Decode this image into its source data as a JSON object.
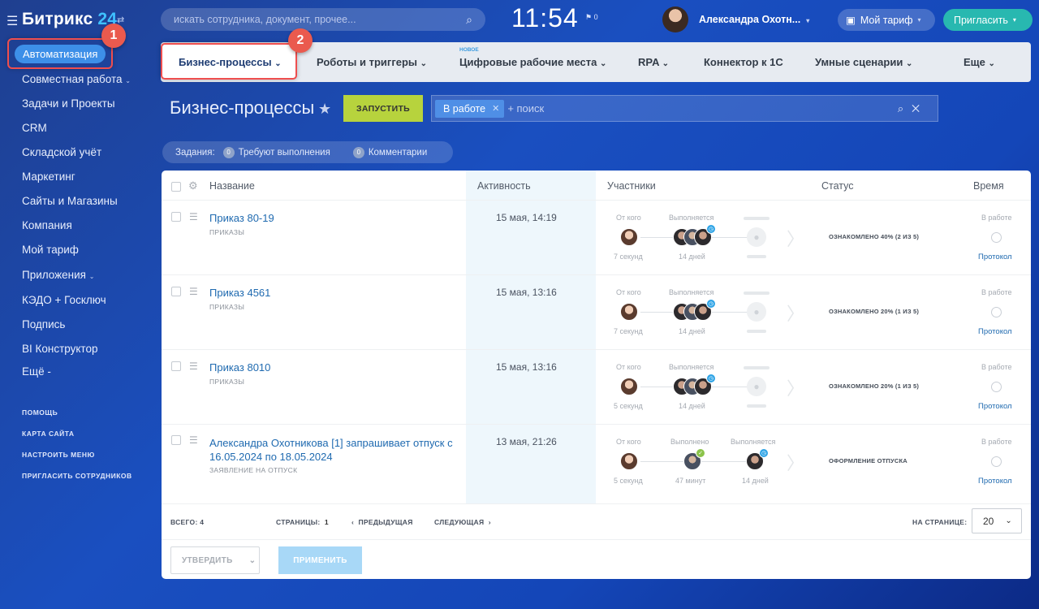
{
  "app": {
    "logo_text": "Битрикс",
    "logo_num": "24"
  },
  "sidebar": {
    "active_item": "Автоматизация",
    "items": [
      "Совместная работа",
      "Задачи и Проекты",
      "CRM",
      "Складской учёт",
      "Маркетинг",
      "Сайты и Магазины",
      "Компания",
      "Мой тариф",
      "Приложения",
      "КЭДО + Госключ",
      "Подпись",
      "BI Конструктор",
      "Ещё -"
    ],
    "small_links": [
      "ПОМОЩЬ",
      "КАРТА САЙТА",
      "НАСТРОИТЬ МЕНЮ",
      "ПРИГЛАСИТЬ СОТРУДНИКОВ"
    ]
  },
  "header": {
    "search_placeholder": "искать сотрудника, документ, прочее...",
    "clock": "11:54",
    "flag_count": "0",
    "user_name": "Александра Охотн...",
    "tariff_label": "Мой тариф",
    "invite_label": "Пригласить"
  },
  "badges": {
    "one": "1",
    "two": "2"
  },
  "topnav": {
    "items": [
      "Бизнес-процессы",
      "Роботы и триггеры",
      "Цифровые рабочие места",
      "RPA",
      "Коннектор к 1С",
      "Умные сценарии",
      "Еще"
    ],
    "new_label": "НОВОЕ"
  },
  "page": {
    "title": "Бизнес-процессы",
    "run_button": "ЗАПУСТИТЬ",
    "filter_chip": "В работе",
    "filter_placeholder": "+ поиск",
    "tasks_label": "Задания:",
    "tasks_pending_count": "0",
    "tasks_pending_label": "Требуют выполнения",
    "tasks_comments_count": "0",
    "tasks_comments_label": "Комментарии"
  },
  "table": {
    "headers": {
      "name": "Название",
      "activity": "Активность",
      "participants": "Участники",
      "status": "Статус",
      "time": "Время"
    },
    "rows": [
      {
        "title": "Приказ 80-19",
        "subtitle": "ПРИКАЗЫ",
        "date": "15 мая, 14:19",
        "from_label": "От кого",
        "from_time": "7 секунд",
        "exec_label": "Выполняется",
        "exec_time": "14 дней",
        "status": "ОЗНАКОМЛЕНО 40% (2 ИЗ 5)",
        "time_label": "В работе",
        "protocol": "Протокол"
      },
      {
        "title": "Приказ 4561",
        "subtitle": "ПРИКАЗЫ",
        "date": "15 мая, 13:16",
        "from_label": "От кого",
        "from_time": "7 секунд",
        "exec_label": "Выполняется",
        "exec_time": "14 дней",
        "status": "ОЗНАКОМЛЕНО 20% (1 ИЗ 5)",
        "time_label": "В работе",
        "protocol": "Протокол"
      },
      {
        "title": "Приказ 8010",
        "subtitle": "ПРИКАЗЫ",
        "date": "15 мая, 13:16",
        "from_label": "От кого",
        "from_time": "5 секунд",
        "exec_label": "Выполняется",
        "exec_time": "14 дней",
        "status": "ОЗНАКОМЛЕНО 20% (1 ИЗ 5)",
        "time_label": "В работе",
        "protocol": "Протокол"
      },
      {
        "title": "Александра Охотникова [1] запрашивает отпуск с 16.05.2024 по 18.05.2024",
        "subtitle": "ЗАЯВЛЕНИЕ НА ОТПУСК",
        "date": "13 мая, 21:26",
        "from_label": "От кого",
        "from_time": "5 секунд",
        "done_label": "Выполнено",
        "done_time": "47 минут",
        "exec_label": "Выполняется",
        "exec_time": "14 дней",
        "status": "ОФОРМЛЕНИЕ ОТПУСКА",
        "time_label": "В работе",
        "protocol": "Протокол"
      }
    ],
    "footer": {
      "total": "ВСЕГО: 4",
      "pages_label": "СТРАНИЦЫ:",
      "page": "1",
      "prev": "ПРЕДЫДУЩАЯ",
      "next": "СЛЕДУЮЩАЯ",
      "per_page_label": "НА СТРАНИЦЕ:",
      "per_page": "20"
    },
    "actions": {
      "approve": "УТВЕРДИТЬ",
      "apply": "ПРИМЕНИТЬ"
    }
  },
  "colors": {
    "accent": "#3d8fe8",
    "highlight": "#ef4e4e",
    "run_button": "#b7d33d",
    "link": "#1f6ab0"
  }
}
